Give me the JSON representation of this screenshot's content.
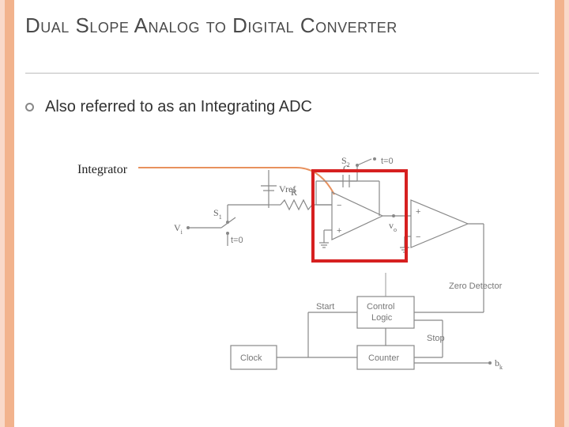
{
  "title": "Dual Slope Analog to Digital Converter",
  "bullet": "Also referred to as an Integrating ADC",
  "callout_label": "Integrator",
  "diagram": {
    "vref": "Vref",
    "vi": "V",
    "vi_sub": "i",
    "s1": "S",
    "s1_sub": "1",
    "s2": "S",
    "s2_sub": "2",
    "t0a": "t=0",
    "t0b": "t=0",
    "r": "R",
    "c": "C",
    "vo": "v",
    "vo_sub": "o",
    "minus": "−",
    "plus": "+",
    "clock": "Clock",
    "counter": "Counter",
    "control": "Control\nLogic",
    "zero": "Zero Detector",
    "start": "Start",
    "stop": "Stop",
    "bk": "b",
    "bk_sub": "k"
  }
}
